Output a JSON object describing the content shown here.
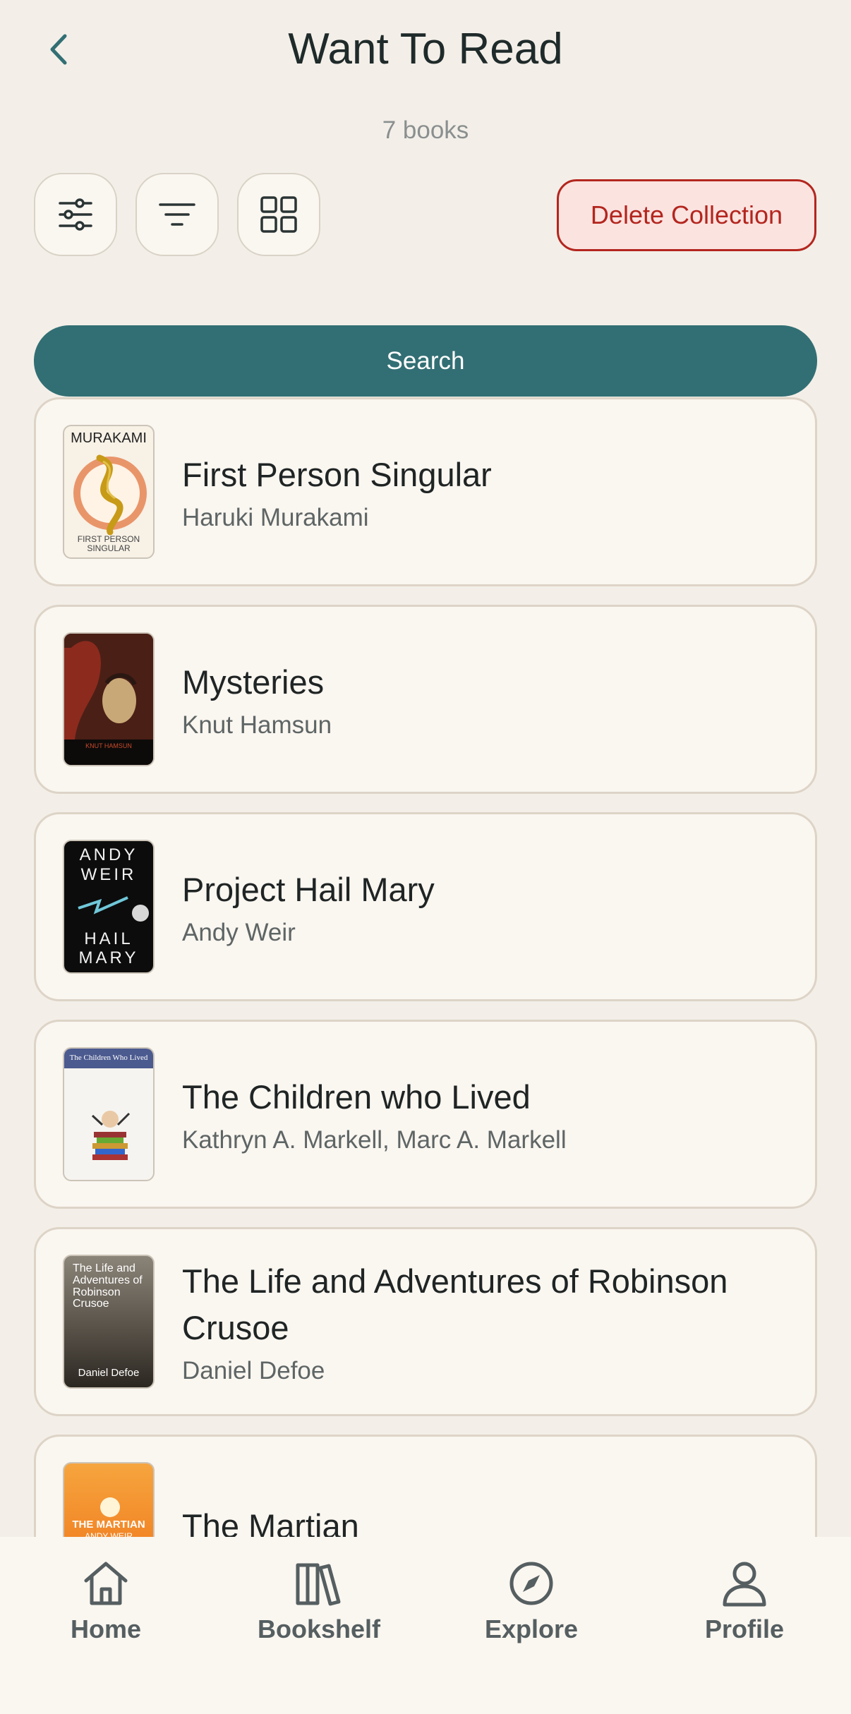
{
  "header": {
    "title": "Want To Read",
    "book_count": "7 books"
  },
  "toolbar": {
    "delete_label": "Delete Collection",
    "search_label": "Search"
  },
  "books": [
    {
      "title": "First Person Singular",
      "author": "Haruki Murakami",
      "cover_text_top": "MURAKAMI",
      "cover_text_bottom": "FIRST PERSON SINGULAR"
    },
    {
      "title": "Mysteries",
      "author": "Knut Hamsun",
      "cover_text_top": "",
      "cover_text_bottom": "KNUT HAMSUN"
    },
    {
      "title": "Project Hail Mary",
      "author": "Andy Weir",
      "cover_text_top": "ANDY WEIR",
      "cover_text_bottom": "HAIL MARY"
    },
    {
      "title": "The Children who Lived",
      "author": "Kathryn A. Markell, Marc A. Markell",
      "cover_text_top": "The Children Who Lived",
      "cover_text_bottom": ""
    },
    {
      "title": "The Life and Adventures of Robinson Crusoe",
      "author": "Daniel Defoe",
      "cover_text_top": "The Life and Adventures of Robinson Crusoe",
      "cover_text_bottom": "Daniel Defoe"
    },
    {
      "title": "The Martian",
      "author": "",
      "cover_text_top": "THE MARTIAN",
      "cover_text_bottom": "ANDY WEIR"
    }
  ],
  "nav": {
    "home": "Home",
    "bookshelf": "Bookshelf",
    "explore": "Explore",
    "profile": "Profile"
  },
  "colors": {
    "background": "#f3efe8",
    "accent": "#326f74",
    "danger": "#b3261e",
    "card": "#faf6f0"
  }
}
